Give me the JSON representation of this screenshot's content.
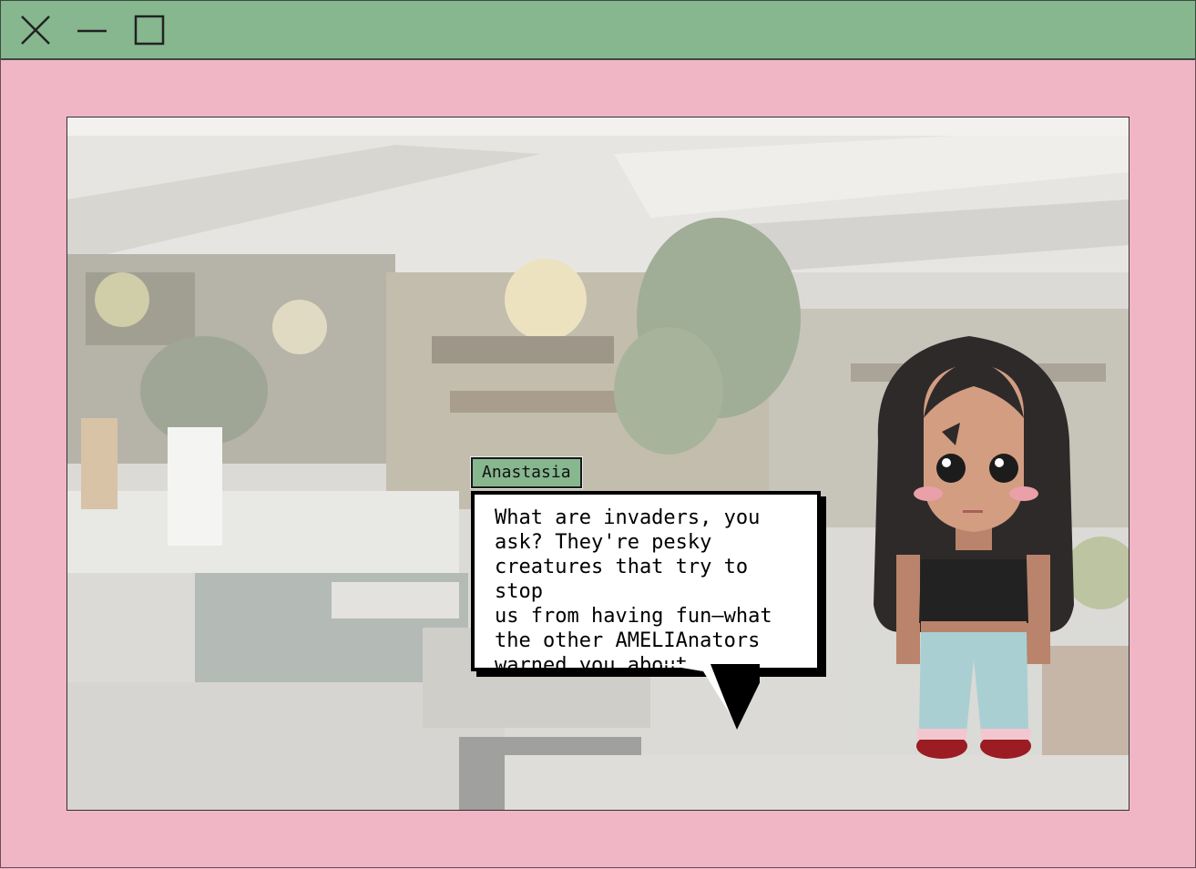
{
  "window": {
    "close_icon": "close-icon",
    "minimize_icon": "minimize-icon",
    "maximize_icon": "maximize-icon",
    "titlebar_color": "#86b78f",
    "frame_color": "#f0b6c6"
  },
  "dialogue": {
    "speaker": "Anastasia",
    "text": "What are invaders, you\nask? They're pesky\ncreatures that try to stop\nus from having fun—what\nthe other AMELIAnators\nwarned you about."
  },
  "scene": {
    "background": "blurred cafe interior",
    "character": "anastasia-sprite"
  }
}
